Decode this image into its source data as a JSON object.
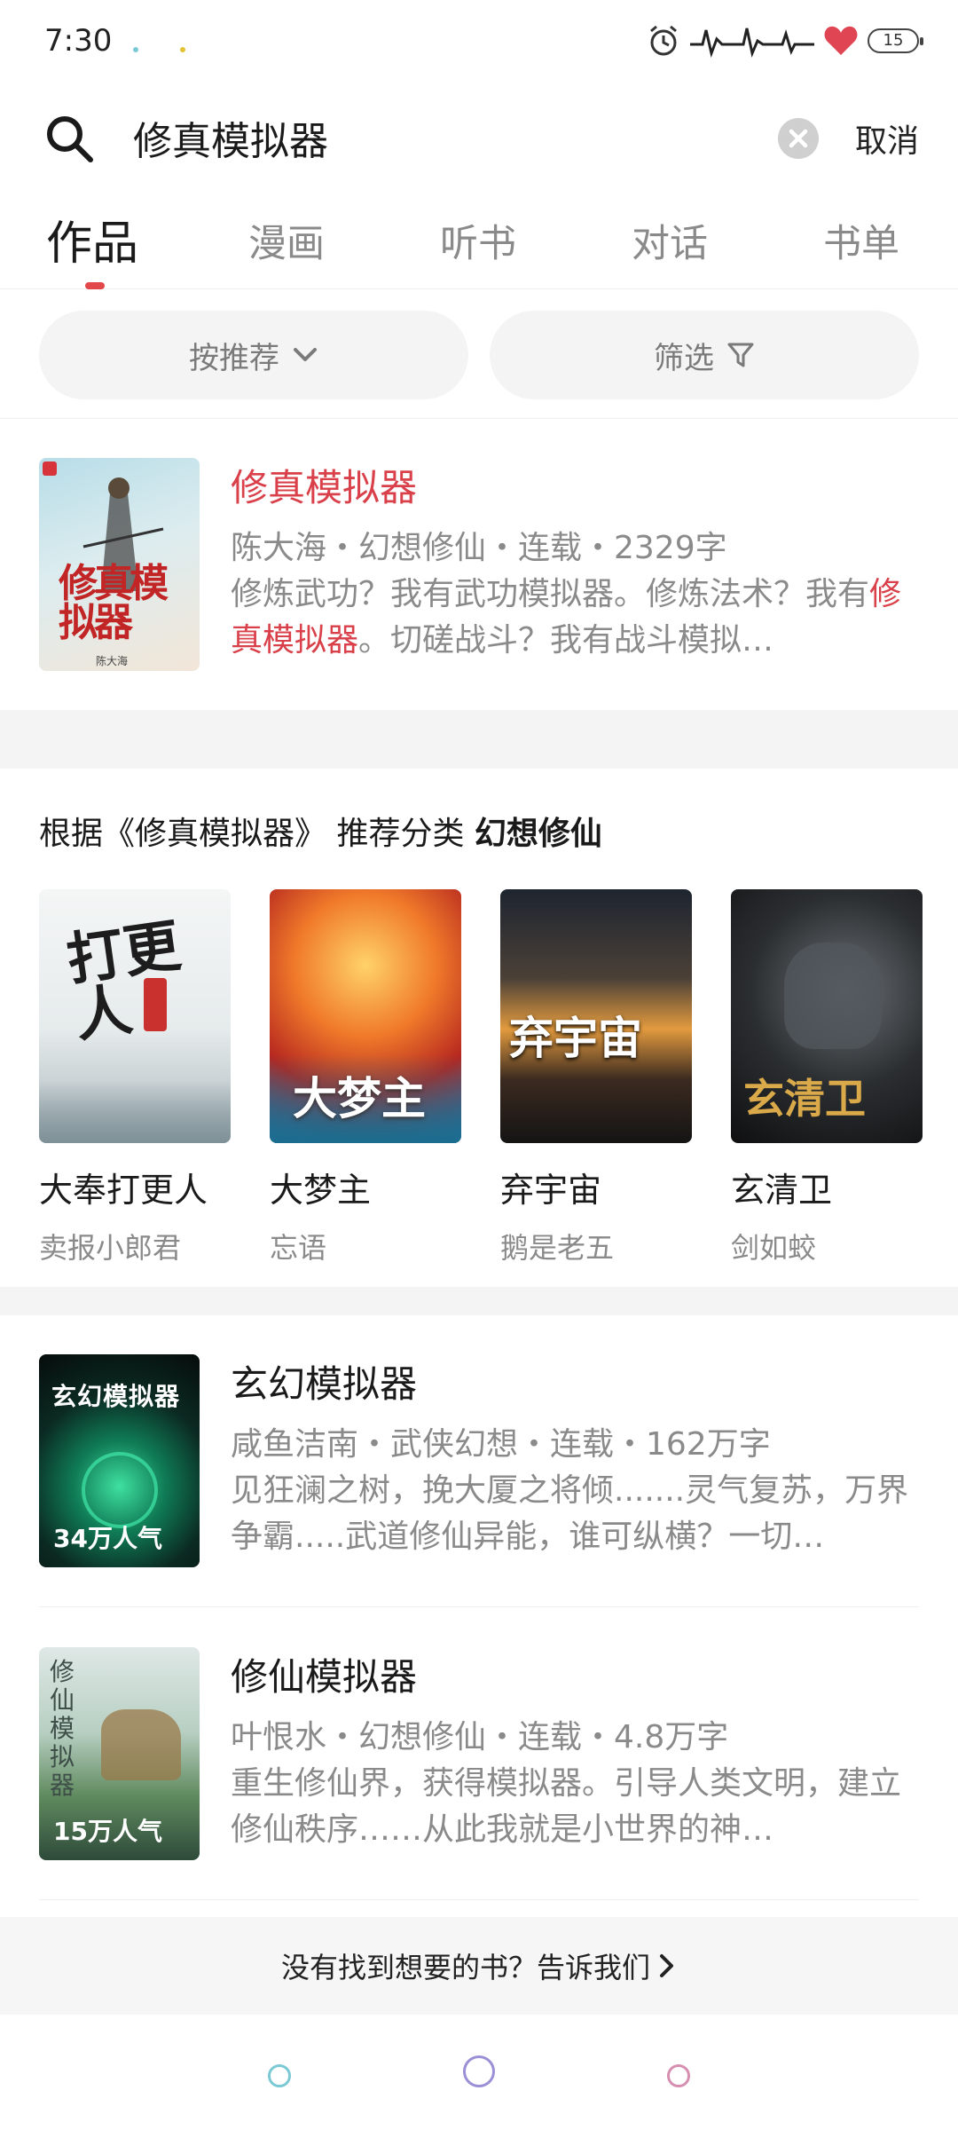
{
  "status": {
    "time": "7:30",
    "battery": "15"
  },
  "search": {
    "query": "修真模拟器",
    "cancel_label": "取消"
  },
  "tabs": [
    "作品",
    "漫画",
    "听书",
    "对话",
    "书单"
  ],
  "filters": {
    "sort_label": "按推荐",
    "filter_label": "筛选"
  },
  "top_result": {
    "title": "修真模拟器",
    "meta": "陈大海・幻想修仙・连载・2329字",
    "desc_part1": "修炼武功？我有武功模拟器。修炼法术？我有",
    "desc_highlight": "修真模拟器",
    "desc_part2": "。切磋战斗？我有战斗模拟…",
    "cover_text": "修真模拟器",
    "cover_author": "陈大海"
  },
  "recommend": {
    "heading_prefix": "根据《修真模拟器》 推荐分类",
    "heading_category": "幻想修仙",
    "books": [
      {
        "title": "大奉打更人",
        "author": "卖报小郎君",
        "cover_text": "打更人"
      },
      {
        "title": "大梦主",
        "author": "忘语",
        "cover_text": "大梦主"
      },
      {
        "title": "弃宇宙",
        "author": "鹅是老五",
        "cover_text": "弃宇宙"
      },
      {
        "title": "玄清卫",
        "author": "剑如蛟",
        "cover_text": "玄清卫"
      }
    ]
  },
  "results": [
    {
      "title": "玄幻模拟器",
      "meta": "咸鱼洁南・武侠幻想・连载・162万字",
      "desc": "见狂澜之树，挽大厦之将倾.......灵气复苏，万界争霸.....武道修仙异能，谁可纵横？一切…",
      "badge": "34万人气",
      "cover_text": "玄幻模拟器"
    },
    {
      "title": "修仙模拟器",
      "meta": "叶恨水・幻想修仙・连载・4.8万字",
      "desc": "重生修仙界，获得模拟器。引导人类文明，建立修仙秩序……从此我就是小世界的神…",
      "badge": "15万人气",
      "cover_text": "修仙模拟器"
    }
  ],
  "feedback": {
    "label": "没有找到想要的书？告诉我们"
  },
  "colors": {
    "accent": "#d9404a",
    "muted": "#8a8a8a",
    "band": "#f4f4f4"
  }
}
